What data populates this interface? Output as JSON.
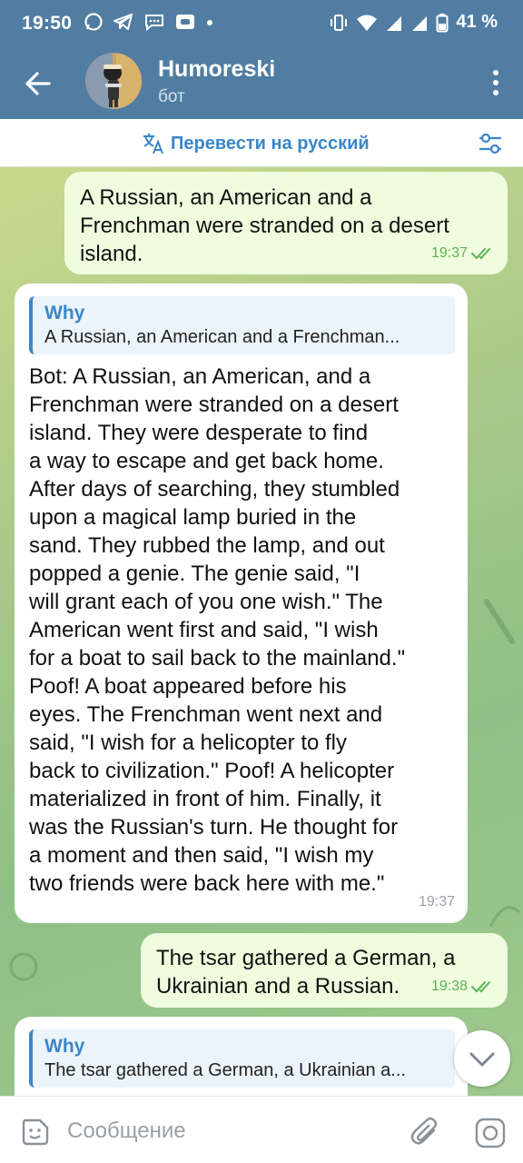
{
  "status_bar": {
    "time": "19:50",
    "battery": "41 %",
    "app_icons": [
      "whatsapp-icon",
      "telegram-icon",
      "chat-bubble-icon",
      "cast-icon",
      "dot-icon"
    ],
    "system_icons": [
      "vibrate-icon",
      "wifi-icon",
      "signal-icon",
      "signal-icon",
      "battery-icon"
    ]
  },
  "header": {
    "title": "Humoreski",
    "subtitle": "бот"
  },
  "translate_bar": {
    "label": "Перевести на русский"
  },
  "messages": [
    {
      "direction": "out",
      "text": "A Russian, an American and a\nFrenchman were stranded on a desert\nisland.",
      "time": "19:37",
      "read": true
    },
    {
      "direction": "in",
      "reply_name": "Why",
      "reply_text": "A Russian, an American and a Frenchman...",
      "text": "Bot: A Russian, an American, and a\nFrenchman were stranded on a desert\nisland. They were desperate to find\na way to escape and get back home.\nAfter days of searching, they stumbled\nupon a magical lamp buried in the\nsand. They rubbed the lamp, and out\npopped a genie. The genie said, \"I\nwill grant each of you one wish.\" The\nAmerican went first and said, \"I wish\nfor a boat to sail back to the mainland.\"\nPoof! A boat appeared before his\neyes. The Frenchman went next and\nsaid, \"I wish for a helicopter to fly\nback to civilization.\" Poof! A helicopter\nmaterialized in front of him. Finally, it\nwas the Russian's turn. He thought for\na moment and then said, \"I wish my\ntwo friends were back here with me.\"",
      "time": "19:37"
    },
    {
      "direction": "out",
      "text": "The tsar gathered a German, a\nUkrainian and a Russian.",
      "time": "19:38",
      "read": true
    },
    {
      "direction": "in",
      "reply_name": "Why",
      "reply_text": "The tsar gathered a German, a Ukrainian a..."
    }
  ],
  "composer": {
    "placeholder": "Сообщение"
  },
  "colors": {
    "header": "#517da2",
    "accent": "#3a86c8",
    "outgoing_bubble": "#effdde",
    "incoming_bubble": "#ffffff",
    "read_check": "#5db055"
  }
}
